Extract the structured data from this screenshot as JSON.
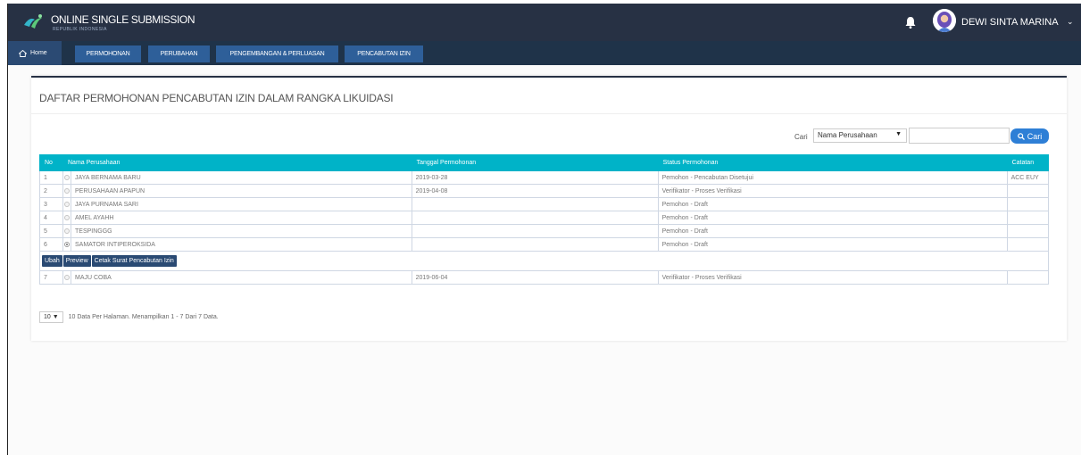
{
  "header": {
    "brand": "ONLINE SINGLE SUBMISSION",
    "brand_sub": "REPUBLIK INDONESIA",
    "user_name": "DEWI SINTA MARINA",
    "icons": {
      "logo": "oss-logo-icon",
      "bell": "bell-icon",
      "chevron": "chevron-down-icon"
    }
  },
  "nav": {
    "home": "Home",
    "items": [
      "PERMOHONAN",
      "PERUBAHAN",
      "PENGEMBANGAN & PERLUASAN",
      "PENCABUTAN IZIN"
    ]
  },
  "page": {
    "title": "DAFTAR PERMOHONAN PENCABUTAN IZIN DALAM RANGKA LIKUIDASI"
  },
  "search": {
    "label": "Cari",
    "filter_value": "Nama Perusahaan",
    "input_value": "",
    "button_label": "Cari"
  },
  "table": {
    "headers": [
      "No",
      "Nama Perusahaan",
      "Tanggal Permohonan",
      "Status Permohonan",
      "Catatan"
    ],
    "rows": [
      {
        "no": "1",
        "nama": "JAYA BERNAMA BARU",
        "tanggal": "2019-03-28",
        "status": "Pemohon - Pencabutan Disetujui",
        "catatan": "ACC EUY",
        "selected": false
      },
      {
        "no": "2",
        "nama": "PERUSAHAAN APAPUN",
        "tanggal": "2019-04-08",
        "status": "Verifikator - Proses Verifikasi",
        "catatan": "",
        "selected": false
      },
      {
        "no": "3",
        "nama": "JAYA PURNAMA SARI",
        "tanggal": "",
        "status": "Pemohon - Draft",
        "catatan": "",
        "selected": false
      },
      {
        "no": "4",
        "nama": "AMEL AYAHH",
        "tanggal": "",
        "status": "Pemohon - Draft",
        "catatan": "",
        "selected": false
      },
      {
        "no": "5",
        "nama": "TESPINGGG",
        "tanggal": "",
        "status": "Pemohon - Draft",
        "catatan": "",
        "selected": false
      },
      {
        "no": "6",
        "nama": "SAMATOR INTIPEROKSIDA",
        "tanggal": "",
        "status": "Pemohon - Draft",
        "catatan": "",
        "selected": true
      },
      {
        "no": "7",
        "nama": "MAJU COBA",
        "tanggal": "2019-06-04",
        "status": "Verifikator - Proses Verifikasi",
        "catatan": "",
        "selected": false
      }
    ],
    "actions": [
      "Ubah",
      "Preview",
      "Cetak Surat Pencabutan Izin"
    ]
  },
  "pager": {
    "per_page": "10",
    "info": "10 Data Per Halaman. Menampilkan 1 - 7 Dari 7 Data."
  },
  "colors": {
    "topbar": "#273144",
    "nav_active": "#2e5f99",
    "table_header": "#00b3c8",
    "search_button": "#2e7fd6",
    "action_button": "#2a4a73"
  }
}
